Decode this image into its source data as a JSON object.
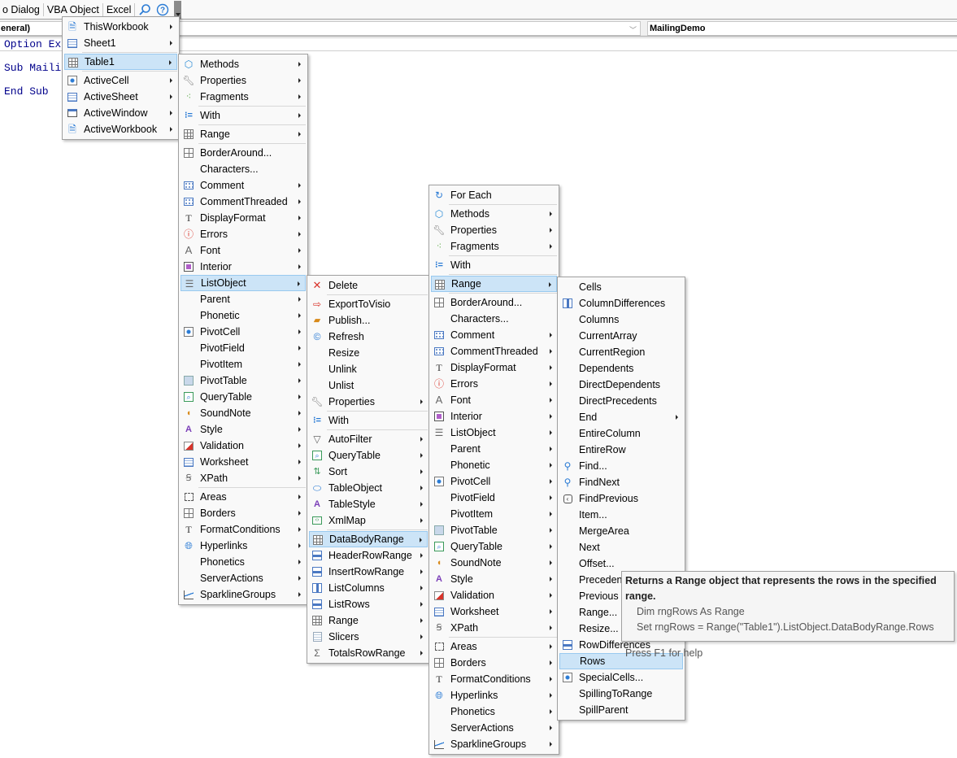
{
  "menubar": {
    "items": [
      "o Dialog",
      "VBA Object",
      "Excel"
    ],
    "search_icon": "search-icon",
    "help_icon": "help-icon"
  },
  "combos": {
    "object": "eneral)",
    "procedure": "MailingDemo"
  },
  "code": {
    "lines": [
      "Option Ex",
      "Sub Maili",
      "End Sub"
    ]
  },
  "menu1": {
    "items": [
      {
        "label": "ThisWorkbook",
        "icon": "workbook-icon",
        "submenu": true
      },
      {
        "label": "Sheet1",
        "icon": "sheet-icon",
        "submenu": true
      },
      {
        "label": "Table1",
        "icon": "table-icon",
        "submenu": true,
        "selected": true
      },
      {
        "label": "ActiveCell",
        "icon": "cell-icon",
        "submenu": true
      },
      {
        "label": "ActiveSheet",
        "icon": "sheet-icon",
        "submenu": true
      },
      {
        "label": "ActiveWindow",
        "icon": "window-icon",
        "submenu": true
      },
      {
        "label": "ActiveWorkbook",
        "icon": "workbook-icon",
        "submenu": true
      }
    ]
  },
  "menu2": {
    "items": [
      {
        "label": "Methods",
        "icon": "cube-icon",
        "submenu": true
      },
      {
        "label": "Properties",
        "icon": "wrench-icon",
        "submenu": true
      },
      {
        "label": "Fragments",
        "icon": "fragments-icon",
        "submenu": true
      },
      {
        "label": "With",
        "icon": "with-icon",
        "submenu": true
      },
      {
        "label": "Range",
        "icon": "range-icon",
        "submenu": true
      },
      {
        "label": "BorderAround...",
        "icon": "border-icon",
        "submenu": false
      },
      {
        "label": "Characters...",
        "icon": "",
        "submenu": false
      },
      {
        "label": "Comment",
        "icon": "comment-icon",
        "submenu": true
      },
      {
        "label": "CommentThreaded",
        "icon": "comment-icon",
        "submenu": true
      },
      {
        "label": "DisplayFormat",
        "icon": "format-icon",
        "submenu": true
      },
      {
        "label": "Errors",
        "icon": "error-icon",
        "submenu": true
      },
      {
        "label": "Font",
        "icon": "font-icon",
        "submenu": true
      },
      {
        "label": "Interior",
        "icon": "interior-icon",
        "submenu": true
      },
      {
        "label": "ListObject",
        "icon": "list-icon",
        "submenu": true,
        "selected": true
      },
      {
        "label": "Parent",
        "icon": "",
        "submenu": true
      },
      {
        "label": "Phonetic",
        "icon": "",
        "submenu": true
      },
      {
        "label": "PivotCell",
        "icon": "cell-icon",
        "submenu": true
      },
      {
        "label": "PivotField",
        "icon": "",
        "submenu": true
      },
      {
        "label": "PivotItem",
        "icon": "",
        "submenu": true
      },
      {
        "label": "PivotTable",
        "icon": "pivot-icon",
        "submenu": true
      },
      {
        "label": "QueryTable",
        "icon": "query-icon",
        "submenu": true
      },
      {
        "label": "SoundNote",
        "icon": "sound-icon",
        "submenu": true
      },
      {
        "label": "Style",
        "icon": "style-icon",
        "submenu": true
      },
      {
        "label": "Validation",
        "icon": "validation-icon",
        "submenu": true
      },
      {
        "label": "Worksheet",
        "icon": "sheet-icon",
        "submenu": true
      },
      {
        "label": "XPath",
        "icon": "xpath-icon",
        "submenu": true
      },
      {
        "label": "Areas",
        "icon": "areas-icon",
        "submenu": true
      },
      {
        "label": "Borders",
        "icon": "border-icon",
        "submenu": true
      },
      {
        "label": "FormatConditions",
        "icon": "format-icon",
        "submenu": true
      },
      {
        "label": "Hyperlinks",
        "icon": "hyperlink-icon",
        "submenu": true
      },
      {
        "label": "Phonetics",
        "icon": "",
        "submenu": true
      },
      {
        "label": "ServerActions",
        "icon": "",
        "submenu": true
      },
      {
        "label": "SparklineGroups",
        "icon": "sparkline-icon",
        "submenu": true
      }
    ]
  },
  "menu3": {
    "items": [
      {
        "label": "Delete",
        "icon": "delete-icon",
        "submenu": false
      },
      {
        "label": "ExportToVisio",
        "icon": "export-icon",
        "submenu": false
      },
      {
        "label": "Publish...",
        "icon": "publish-icon",
        "submenu": false
      },
      {
        "label": "Refresh",
        "icon": "refresh-icon",
        "submenu": false
      },
      {
        "label": "Resize",
        "icon": "",
        "submenu": false
      },
      {
        "label": "Unlink",
        "icon": "",
        "submenu": false
      },
      {
        "label": "Unlist",
        "icon": "",
        "submenu": false
      },
      {
        "label": "Properties",
        "icon": "wrench-icon",
        "submenu": true
      },
      {
        "label": "With",
        "icon": "with-icon",
        "submenu": false
      },
      {
        "label": "AutoFilter",
        "icon": "filter-icon",
        "submenu": true
      },
      {
        "label": "QueryTable",
        "icon": "query-icon",
        "submenu": true
      },
      {
        "label": "Sort",
        "icon": "sort-icon",
        "submenu": true
      },
      {
        "label": "TableObject",
        "icon": "tableobject-icon",
        "submenu": true
      },
      {
        "label": "TableStyle",
        "icon": "style-icon",
        "submenu": true
      },
      {
        "label": "XmlMap",
        "icon": "xmlmap-icon",
        "submenu": true
      },
      {
        "label": "DataBodyRange",
        "icon": "range-icon",
        "submenu": true,
        "selected": true
      },
      {
        "label": "HeaderRowRange",
        "icon": "header-row-icon",
        "submenu": true
      },
      {
        "label": "InsertRowRange",
        "icon": "header-row-icon",
        "submenu": true
      },
      {
        "label": "ListColumns",
        "icon": "columns-icon",
        "submenu": true
      },
      {
        "label": "ListRows",
        "icon": "header-row-icon",
        "submenu": true
      },
      {
        "label": "Range",
        "icon": "range-icon",
        "submenu": true
      },
      {
        "label": "Slicers",
        "icon": "slicer-icon",
        "submenu": true
      },
      {
        "label": "TotalsRowRange",
        "icon": "sigma-icon",
        "submenu": true
      }
    ]
  },
  "menu4": {
    "items": [
      {
        "label": "For Each",
        "icon": "foreach-icon",
        "submenu": false
      },
      {
        "label": "Methods",
        "icon": "cube-icon",
        "submenu": true
      },
      {
        "label": "Properties",
        "icon": "wrench-icon",
        "submenu": true
      },
      {
        "label": "Fragments",
        "icon": "fragments-icon",
        "submenu": true
      },
      {
        "label": "With",
        "icon": "with-icon",
        "submenu": false
      },
      {
        "label": "Range",
        "icon": "range-icon",
        "submenu": true,
        "selected": true
      },
      {
        "label": "BorderAround...",
        "icon": "border-icon",
        "submenu": false
      },
      {
        "label": "Characters...",
        "icon": "",
        "submenu": false
      },
      {
        "label": "Comment",
        "icon": "comment-icon",
        "submenu": true
      },
      {
        "label": "CommentThreaded",
        "icon": "comment-icon",
        "submenu": true
      },
      {
        "label": "DisplayFormat",
        "icon": "format-icon",
        "submenu": true
      },
      {
        "label": "Errors",
        "icon": "error-icon",
        "submenu": true
      },
      {
        "label": "Font",
        "icon": "font-icon",
        "submenu": true
      },
      {
        "label": "Interior",
        "icon": "interior-icon",
        "submenu": true
      },
      {
        "label": "ListObject",
        "icon": "list-icon",
        "submenu": true
      },
      {
        "label": "Parent",
        "icon": "",
        "submenu": true
      },
      {
        "label": "Phonetic",
        "icon": "",
        "submenu": true
      },
      {
        "label": "PivotCell",
        "icon": "cell-icon",
        "submenu": true
      },
      {
        "label": "PivotField",
        "icon": "",
        "submenu": true
      },
      {
        "label": "PivotItem",
        "icon": "",
        "submenu": true
      },
      {
        "label": "PivotTable",
        "icon": "pivot-icon",
        "submenu": true
      },
      {
        "label": "QueryTable",
        "icon": "query-icon",
        "submenu": true
      },
      {
        "label": "SoundNote",
        "icon": "sound-icon",
        "submenu": true
      },
      {
        "label": "Style",
        "icon": "style-icon",
        "submenu": true
      },
      {
        "label": "Validation",
        "icon": "validation-icon",
        "submenu": true
      },
      {
        "label": "Worksheet",
        "icon": "sheet-icon",
        "submenu": true
      },
      {
        "label": "XPath",
        "icon": "xpath-icon",
        "submenu": true
      },
      {
        "label": "Areas",
        "icon": "areas-icon",
        "submenu": true
      },
      {
        "label": "Borders",
        "icon": "border-icon",
        "submenu": true
      },
      {
        "label": "FormatConditions",
        "icon": "format-icon",
        "submenu": true
      },
      {
        "label": "Hyperlinks",
        "icon": "hyperlink-icon",
        "submenu": true
      },
      {
        "label": "Phonetics",
        "icon": "",
        "submenu": true
      },
      {
        "label": "ServerActions",
        "icon": "",
        "submenu": true
      },
      {
        "label": "SparklineGroups",
        "icon": "sparkline-icon",
        "submenu": true
      }
    ]
  },
  "menu5": {
    "items": [
      {
        "label": "Cells",
        "icon": "",
        "submenu": false
      },
      {
        "label": "ColumnDifferences",
        "icon": "columns-icon",
        "submenu": false
      },
      {
        "label": "Columns",
        "icon": "",
        "submenu": false
      },
      {
        "label": "CurrentArray",
        "icon": "",
        "submenu": false
      },
      {
        "label": "CurrentRegion",
        "icon": "",
        "submenu": false
      },
      {
        "label": "Dependents",
        "icon": "",
        "submenu": false
      },
      {
        "label": "DirectDependents",
        "icon": "",
        "submenu": false
      },
      {
        "label": "DirectPrecedents",
        "icon": "",
        "submenu": false
      },
      {
        "label": "End",
        "icon": "",
        "submenu": true
      },
      {
        "label": "EntireColumn",
        "icon": "",
        "submenu": false
      },
      {
        "label": "EntireRow",
        "icon": "",
        "submenu": false
      },
      {
        "label": "Find...",
        "icon": "find-icon",
        "submenu": false
      },
      {
        "label": "FindNext",
        "icon": "findnext-icon",
        "submenu": false
      },
      {
        "label": "FindPrevious",
        "icon": "findprev-icon",
        "submenu": false
      },
      {
        "label": "Item...",
        "icon": "",
        "submenu": false
      },
      {
        "label": "MergeArea",
        "icon": "",
        "submenu": false
      },
      {
        "label": "Next",
        "icon": "",
        "submenu": false
      },
      {
        "label": "Offset...",
        "icon": "",
        "submenu": false
      },
      {
        "label": "Precedents",
        "icon": "",
        "submenu": false
      },
      {
        "label": "Previous",
        "icon": "",
        "submenu": false
      },
      {
        "label": "Range...",
        "icon": "",
        "submenu": false
      },
      {
        "label": "Resize...",
        "icon": "",
        "submenu": false
      },
      {
        "label": "RowDifferences",
        "icon": "header-row-icon",
        "submenu": false
      },
      {
        "label": "Rows",
        "icon": "",
        "submenu": false,
        "selected": true
      },
      {
        "label": "SpecialCells...",
        "icon": "cell-icon",
        "submenu": false
      },
      {
        "label": "SpillingToRange",
        "icon": "",
        "submenu": false
      },
      {
        "label": "SpillParent",
        "icon": "",
        "submenu": false
      }
    ]
  },
  "tooltip": {
    "title": "Returns a Range object that represents the rows in the specified range.",
    "example_line1": "Dim rngRows As Range",
    "example_line2": "Set rngRows = Range(\"Table1\").ListObject.DataBodyRange.Rows",
    "help": "Press F1 for help"
  }
}
